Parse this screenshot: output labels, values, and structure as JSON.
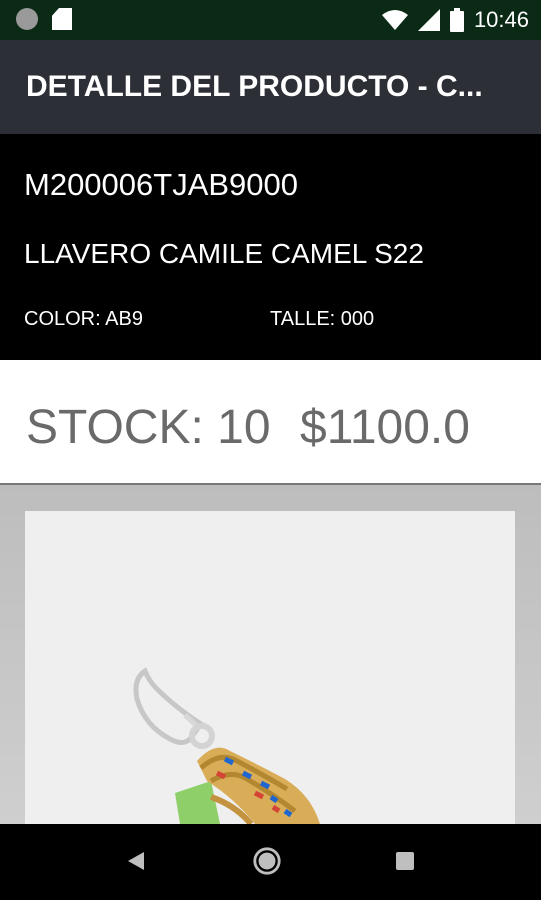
{
  "status_bar": {
    "time": "10:46",
    "icons": [
      "notification-dot-icon",
      "sd-card-icon",
      "wifi-icon",
      "cell-signal-icon",
      "battery-icon"
    ]
  },
  "app_bar": {
    "title": "DETALLE DEL PRODUCTO - C..."
  },
  "product": {
    "sku": "M200006TJAB9000",
    "name": "LLAVERO CAMILE CAMEL S22",
    "color": "COLOR: AB9",
    "size": "TALLE: 000",
    "stock": "STOCK: 10",
    "price": "$1100.0"
  },
  "nav_bar": {
    "buttons": [
      "back-icon",
      "home-icon",
      "recent-apps-icon"
    ]
  }
}
